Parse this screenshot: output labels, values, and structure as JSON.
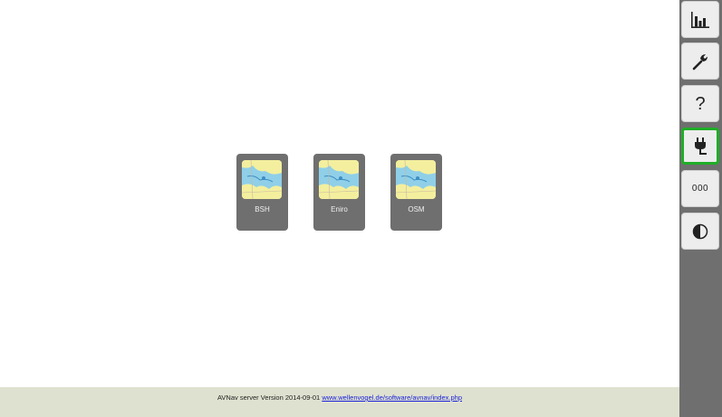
{
  "charts": [
    {
      "name": "BSH"
    },
    {
      "name": "Eniro"
    },
    {
      "name": "OSM"
    }
  ],
  "footer": {
    "version_text": "AVNav server Version 2014-09-01",
    "link_text": "www.wellenvogel.de/software/avnav/index.php"
  },
  "sidebar": {
    "buttons": [
      {
        "icon": "bar-chart-icon"
      },
      {
        "icon": "wrench-icon"
      },
      {
        "icon": "help-icon",
        "label": "?"
      },
      {
        "icon": "plug-icon",
        "active": true
      },
      {
        "icon": "number-icon",
        "label": "000"
      },
      {
        "icon": "contrast-icon"
      }
    ]
  },
  "colors": {
    "sidebar_bg": "#6f6f6f",
    "button_bg": "#ededed",
    "active_border": "#1fae27",
    "footer_bg": "#dfe1d0",
    "tile_bg": "#6f6f6f",
    "link": "#1a22d8"
  }
}
